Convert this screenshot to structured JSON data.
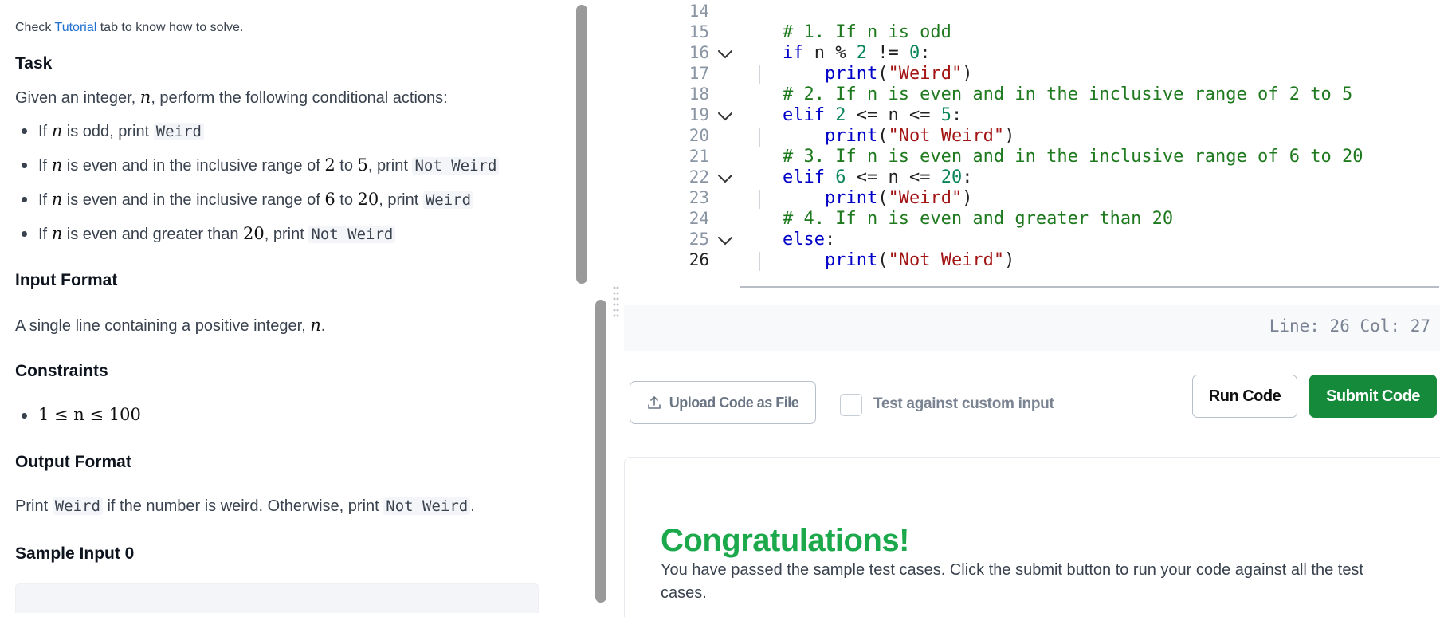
{
  "problem": {
    "hint_prefix": "Check",
    "hint_link": "Tutorial",
    "hint_suffix": "tab to know how to solve.",
    "task_heading": "Task",
    "task_intro_pre": "Given an integer,",
    "task_intro_var": "n",
    "task_intro_post": ", perform the following conditional actions:",
    "bullets": [
      {
        "pre": "If",
        "var": "n",
        "mid": "is odd, print",
        "code": "Weird"
      },
      {
        "pre": "If",
        "var": "n",
        "mid": "is even and in the inclusive range of",
        "a": "2",
        "to": "to",
        "b": "5",
        "post": ", print",
        "code": "Not Weird"
      },
      {
        "pre": "If",
        "var": "n",
        "mid": "is even and in the inclusive range of",
        "a": "6",
        "to": "to",
        "b": "20",
        "post": ", print",
        "code": "Weird"
      },
      {
        "pre": "If",
        "var": "n",
        "mid": "is even and greater than",
        "a": "20",
        "post": ", print",
        "code": "Not Weird"
      }
    ],
    "input_heading": "Input Format",
    "input_text": "A single line containing a positive integer,",
    "input_var": "n",
    "constraints_heading": "Constraints",
    "constraint": "1 ≤ n ≤ 100",
    "output_heading": "Output Format",
    "output_pre": "Print",
    "output_code1": "Weird",
    "output_mid": "if the number is weird. Otherwise, print",
    "output_code2": "Not Weird",
    "output_end": ".",
    "sample_heading": "Sample Input 0"
  },
  "editor": {
    "lines": [
      {
        "n": "14",
        "fold": false,
        "code": ""
      },
      {
        "n": "15",
        "fold": false,
        "code": "# 1. If n is odd"
      },
      {
        "n": "16",
        "fold": true,
        "code": "if n % 2 != 0:"
      },
      {
        "n": "17",
        "fold": false,
        "code": "    print(\"Weird\")"
      },
      {
        "n": "18",
        "fold": false,
        "code": "# 2. If n is even and in the inclusive range of 2 to 5"
      },
      {
        "n": "19",
        "fold": true,
        "code": "elif 2 <= n <= 5:"
      },
      {
        "n": "20",
        "fold": false,
        "code": "    print(\"Not Weird\")"
      },
      {
        "n": "21",
        "fold": false,
        "code": "# 3. If n is even and in the inclusive range of 6 to 20"
      },
      {
        "n": "22",
        "fold": true,
        "code": "elif 6 <= n <= 20:"
      },
      {
        "n": "23",
        "fold": false,
        "code": "    print(\"Weird\")"
      },
      {
        "n": "24",
        "fold": false,
        "code": "# 4. If n is even and greater than 20"
      },
      {
        "n": "25",
        "fold": true,
        "code": "else:"
      },
      {
        "n": "26",
        "fold": false,
        "code": "    print(\"Not Weird\")"
      }
    ],
    "status": "Line: 26 Col: 27"
  },
  "actions": {
    "upload_label": "Upload Code as File",
    "custom_input_label": "Test against custom input",
    "run_label": "Run Code",
    "submit_label": "Submit Code"
  },
  "result": {
    "title": "Congratulations!",
    "message": "You have passed the sample test cases. Click the submit button to run your code against all the test cases."
  },
  "colors": {
    "success": "#1ba94c",
    "submit_bg": "#158a3a",
    "link": "#1f6fd1"
  }
}
